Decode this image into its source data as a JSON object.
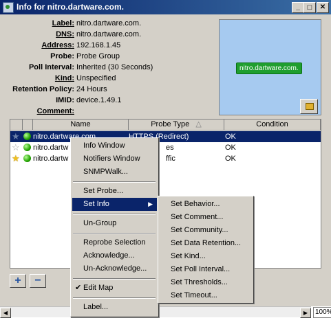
{
  "window": {
    "title": "Info for nitro.dartware.com.",
    "controls": {
      "minimize": "_",
      "maximize": "□",
      "close": "✕"
    }
  },
  "properties": [
    {
      "label": "Label:",
      "value": "nitro.dartware.com.",
      "underline": true
    },
    {
      "label": "DNS:",
      "value": "nitro.dartware.com.",
      "underline": true
    },
    {
      "label": "Address:",
      "value": "192.168.1.45",
      "underline": true
    },
    {
      "label": "Probe:",
      "value": "Probe Group",
      "underline": false
    },
    {
      "label": "Poll Interval:",
      "value": "Inherited (30 Seconds)",
      "underline": false
    },
    {
      "label": "Kind:",
      "value": "Unspecified",
      "underline": true
    },
    {
      "label": "Retention Policy:",
      "value": "24 Hours",
      "underline": false
    },
    {
      "label": "IMID:",
      "value": "device.1.49.1",
      "underline": false
    },
    {
      "label": "Comment:",
      "value": "",
      "underline": true
    }
  ],
  "map": {
    "device_label": "nitro.dartware.com.",
    "lock_icon": "lock-icon"
  },
  "table": {
    "columns": {
      "name": "Name",
      "probe_type": "Probe Type",
      "condition": "Condition",
      "sort_indicator": "△"
    },
    "rows": [
      {
        "star": "★",
        "star_color": "#6a7fa8",
        "name": "nitro.dartware.com.",
        "probe_type": "HTTPS (Redirect)",
        "condition": "OK",
        "selected": true
      },
      {
        "star": "☆",
        "star_color": "#a0a0a0",
        "name": "nitro.dartw",
        "probe_type": "es",
        "condition": "OK",
        "selected": false
      },
      {
        "star": "★",
        "star_color": "#f0c020",
        "name": "nitro.dartw",
        "probe_type": "ffic",
        "condition": "OK",
        "selected": false
      }
    ]
  },
  "buttons": {
    "add": "+",
    "remove": "−"
  },
  "status": {
    "zoom": "100%"
  },
  "context_menu": {
    "items": [
      {
        "label": "Info Window"
      },
      {
        "label": "Notifiers Window"
      },
      {
        "label": "SNMPWalk..."
      },
      {
        "label": "Set Probe..."
      },
      {
        "label": "Set Info",
        "submenu_arrow": "▶"
      },
      {
        "label": "Un-Group"
      },
      {
        "label": "Reprobe Selection"
      },
      {
        "label": "Acknowledge..."
      },
      {
        "label": "Un-Acknowledge..."
      },
      {
        "label": "Edit Map",
        "check": "✔"
      },
      {
        "label": "Label..."
      }
    ]
  },
  "submenu": {
    "items": [
      {
        "label": "Set Behavior..."
      },
      {
        "label": "Set Comment..."
      },
      {
        "label": "Set Community..."
      },
      {
        "label": "Set Data Retention..."
      },
      {
        "label": "Set Kind..."
      },
      {
        "label": "Set Poll Interval..."
      },
      {
        "label": "Set Thresholds..."
      },
      {
        "label": "Set Timeout..."
      }
    ]
  }
}
